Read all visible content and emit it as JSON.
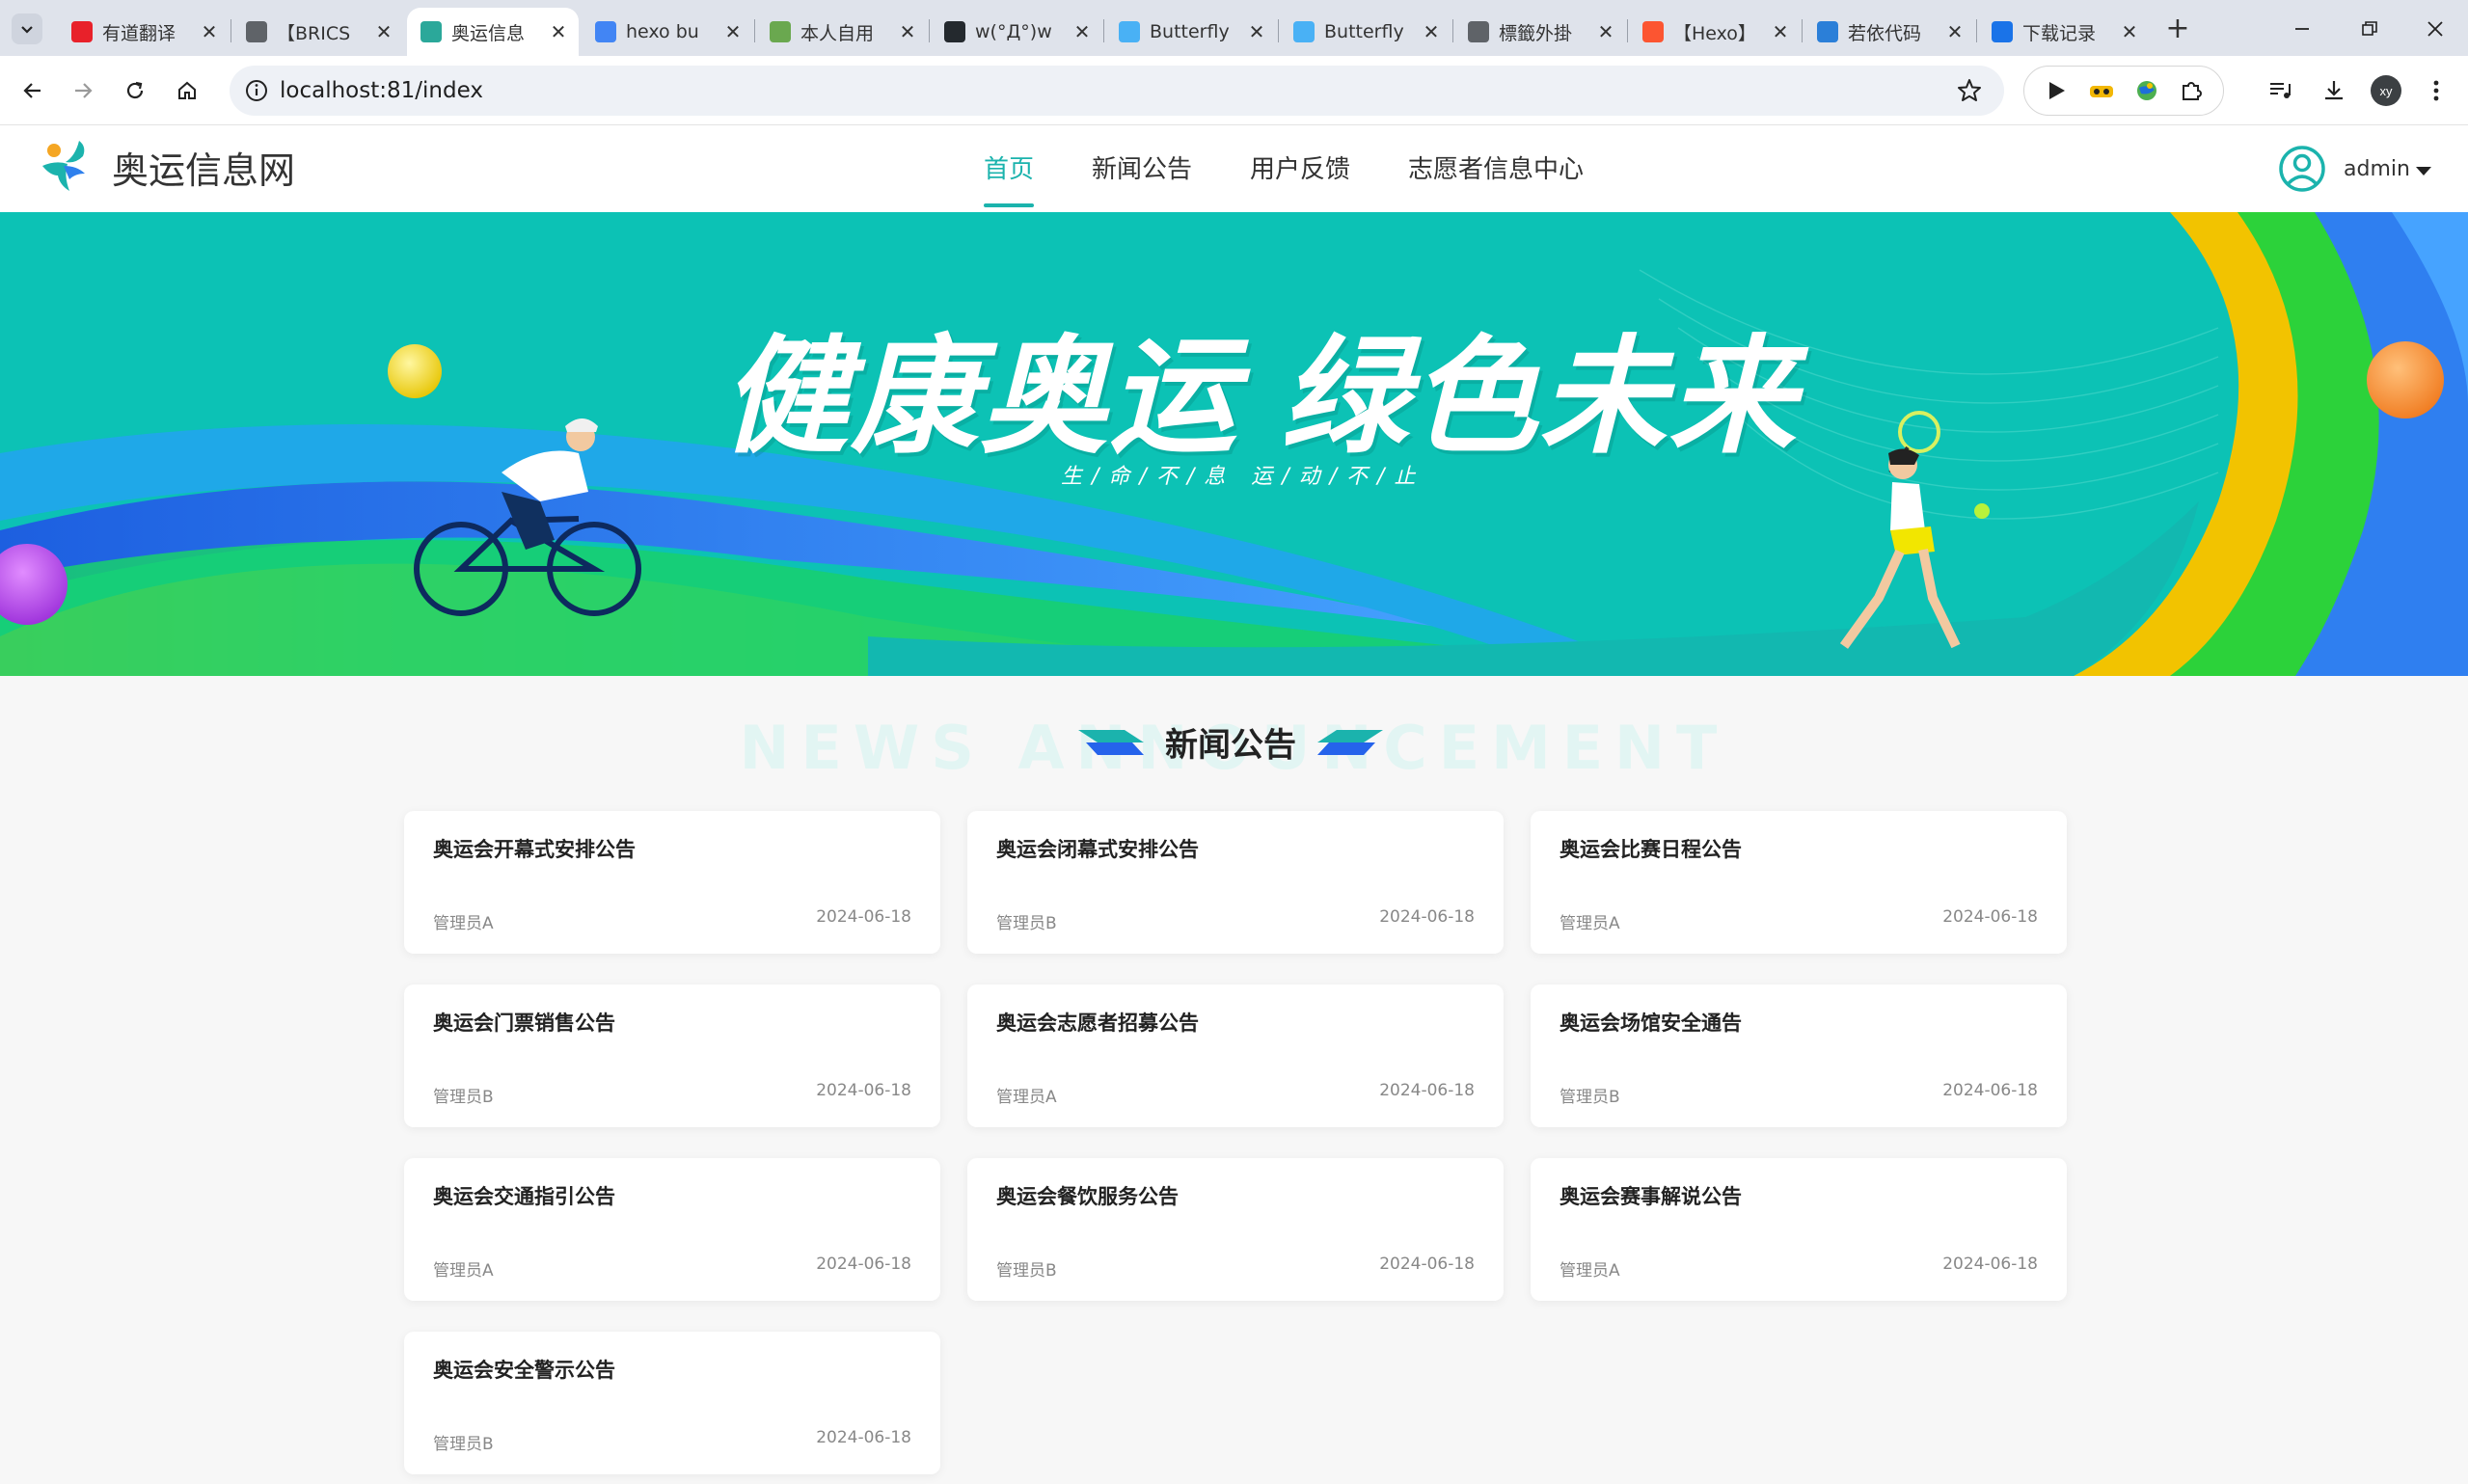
{
  "browser": {
    "tabs": [
      {
        "label": "有道翻译",
        "icon": "youdao-icon",
        "color": "#e8212a"
      },
      {
        "label": "【BRICS",
        "icon": "globe-icon",
        "color": "#5f6368"
      },
      {
        "label": "奥运信息",
        "icon": "leaf-icon",
        "color": "#2ba89a",
        "active": true
      },
      {
        "label": "hexo bu",
        "icon": "google-icon",
        "color": "#4285f4"
      },
      {
        "label": "本人自用",
        "icon": "site-icon",
        "color": "#6aa84f"
      },
      {
        "label": "w(°Д°)w",
        "icon": "github-icon",
        "color": "#24292e"
      },
      {
        "label": "Butterfly",
        "icon": "butterfly-icon",
        "color": "#49b1f5"
      },
      {
        "label": "Butterfly",
        "icon": "butterfly-icon",
        "color": "#49b1f5"
      },
      {
        "label": "標籤外掛",
        "icon": "globe-icon",
        "color": "#5f6368"
      },
      {
        "label": "【Hexo】",
        "icon": "csdn-icon",
        "color": "#fc5531"
      },
      {
        "label": "若依代码",
        "icon": "leaf-icon",
        "color": "#2b7fd8"
      },
      {
        "label": "下载记录",
        "icon": "download-icon",
        "color": "#1a73e8"
      }
    ],
    "url": "localhost:81/index"
  },
  "site": {
    "brand": "奥运信息网",
    "nav": [
      "首页",
      "新闻公告",
      "用户反馈",
      "志愿者信息中心"
    ],
    "user": "admin"
  },
  "banner": {
    "headline_a": "健康奥运",
    "headline_b": "绿色未来",
    "subline": "生/命/不/息 运/动/不/止"
  },
  "news": {
    "title": "新闻公告",
    "watermark": "NEWS ANNOUNCEMENT",
    "items": [
      {
        "title": "奥运会开幕式安排公告",
        "author": "管理员A",
        "date": "2024-06-18"
      },
      {
        "title": "奥运会闭幕式安排公告",
        "author": "管理员B",
        "date": "2024-06-18"
      },
      {
        "title": "奥运会比赛日程公告",
        "author": "管理员A",
        "date": "2024-06-18"
      },
      {
        "title": "奥运会门票销售公告",
        "author": "管理员B",
        "date": "2024-06-18"
      },
      {
        "title": "奥运会志愿者招募公告",
        "author": "管理员A",
        "date": "2024-06-18"
      },
      {
        "title": "奥运会场馆安全通告",
        "author": "管理员B",
        "date": "2024-06-18"
      },
      {
        "title": "奥运会交通指引公告",
        "author": "管理员A",
        "date": "2024-06-18"
      },
      {
        "title": "奥运会餐饮服务公告",
        "author": "管理员B",
        "date": "2024-06-18"
      },
      {
        "title": "奥运会赛事解说公告",
        "author": "管理员A",
        "date": "2024-06-18"
      },
      {
        "title": "奥运会安全警示公告",
        "author": "管理员B",
        "date": "2024-06-18"
      }
    ]
  },
  "colors": {
    "accent": "#1bb3ad",
    "banner_teal": "#0cc2b5"
  }
}
